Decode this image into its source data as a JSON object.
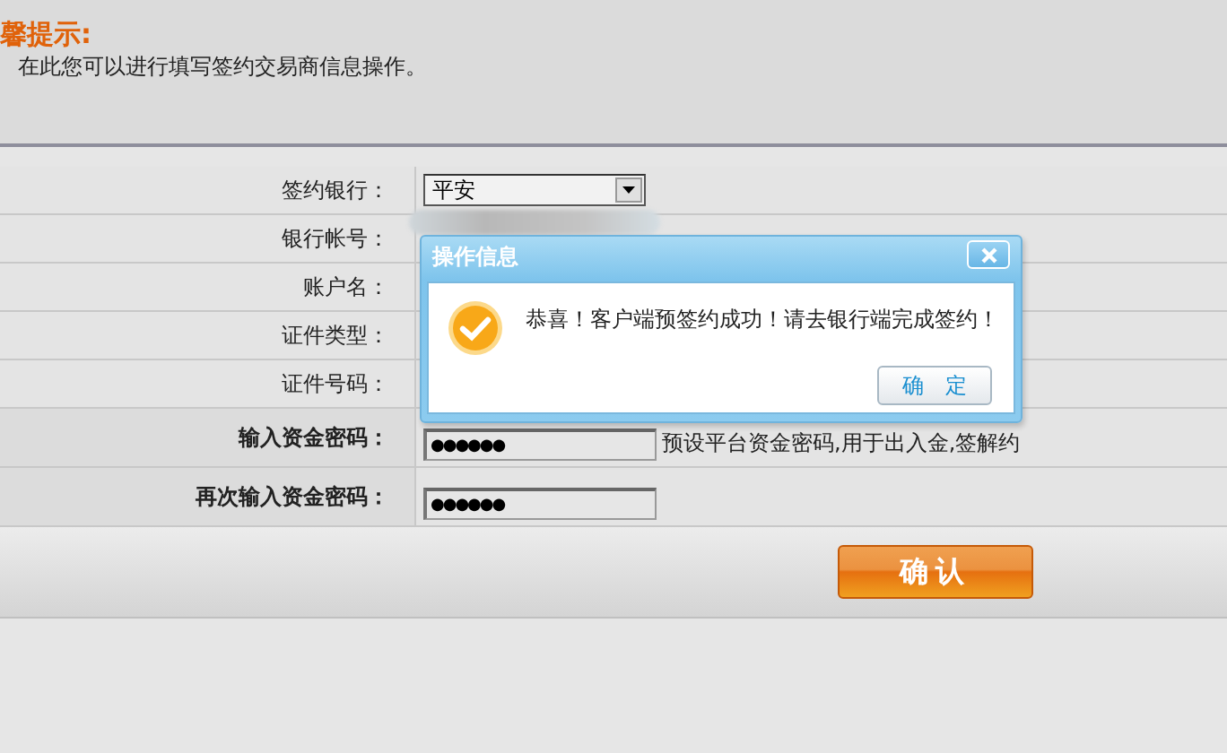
{
  "tip": {
    "title": "馨提示:",
    "text": "在此您可以进行填写签约交易商信息操作。"
  },
  "form": {
    "rows": [
      {
        "label": "签约银行：",
        "kind": "select",
        "value": "平安",
        "emphasis": false
      },
      {
        "label": "银行帐号：",
        "kind": "covered",
        "emphasis": false
      },
      {
        "label": "账户名：",
        "kind": "covered",
        "emphasis": false
      },
      {
        "label": "证件类型：",
        "kind": "covered",
        "emphasis": false
      },
      {
        "label": "证件号码：",
        "kind": "covered",
        "emphasis": false
      },
      {
        "label": "输入资金密码：",
        "kind": "password",
        "value": "●●●●●●",
        "hint": "预设平台资金密码,用于出入金,签解约",
        "emphasis": true
      },
      {
        "label": "再次输入资金密码：",
        "kind": "password",
        "value": "●●●●●●",
        "emphasis": true
      }
    ],
    "submit": "确认"
  },
  "dialog": {
    "title": "操作信息",
    "message": "恭喜！客户端预签约成功！请去银行端完成签约！",
    "ok": "确　定"
  }
}
